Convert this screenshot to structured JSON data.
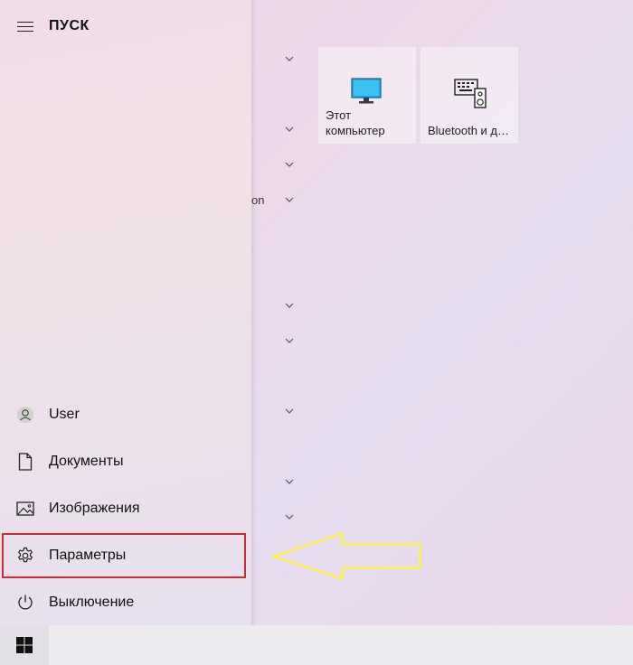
{
  "start_menu": {
    "title": "ПУСК",
    "nav_items": [
      {
        "label": "User",
        "icon": "user-avatar-icon"
      },
      {
        "label": "Документы",
        "icon": "document-icon"
      },
      {
        "label": "Изображения",
        "icon": "picture-icon"
      },
      {
        "label": "Параметры",
        "icon": "gear-icon"
      },
      {
        "label": "Выключение",
        "icon": "power-icon"
      }
    ],
    "app_list": {
      "partial_text": "on",
      "group_chevron_count": 10
    },
    "tiles": [
      {
        "label": "Этот\nкомпьютер",
        "icon": "monitor-icon"
      },
      {
        "label": "Bluetooth и д…",
        "icon": "devices-icon"
      }
    ],
    "highlighted_item": "Параметры"
  },
  "annotation": {
    "arrow_color": "#fff24a",
    "box_color": "#d12a32"
  },
  "taskbar": {
    "start_icon": "windows-logo-icon"
  }
}
